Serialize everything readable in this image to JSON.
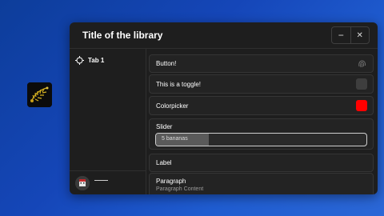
{
  "desktop": {
    "icon_name": "game-app-icon",
    "background_colors": [
      "#0d3d9a",
      "#2b67d6"
    ]
  },
  "window": {
    "title": "Title of the library",
    "minimize_symbol": "−",
    "close_symbol": "✕"
  },
  "sidebar": {
    "tabs": [
      {
        "label": "Tab 1",
        "icon": "crosshair-icon"
      }
    ],
    "footer": {
      "avatar_icon": "avatar"
    }
  },
  "elements": {
    "button": {
      "label": "Button!",
      "icon": "fingerprint-icon"
    },
    "toggle": {
      "label": "This is a toggle!",
      "state": false
    },
    "colorpicker": {
      "label": "Colorpicker",
      "color": "#ff0000"
    },
    "slider": {
      "label": "Slider",
      "value_text": "5 bananas",
      "value": 5,
      "fill_fraction": 0.25
    },
    "label": {
      "text": "Label"
    },
    "paragraph": {
      "title": "Paragraph",
      "content": "Paragraph Content"
    }
  }
}
